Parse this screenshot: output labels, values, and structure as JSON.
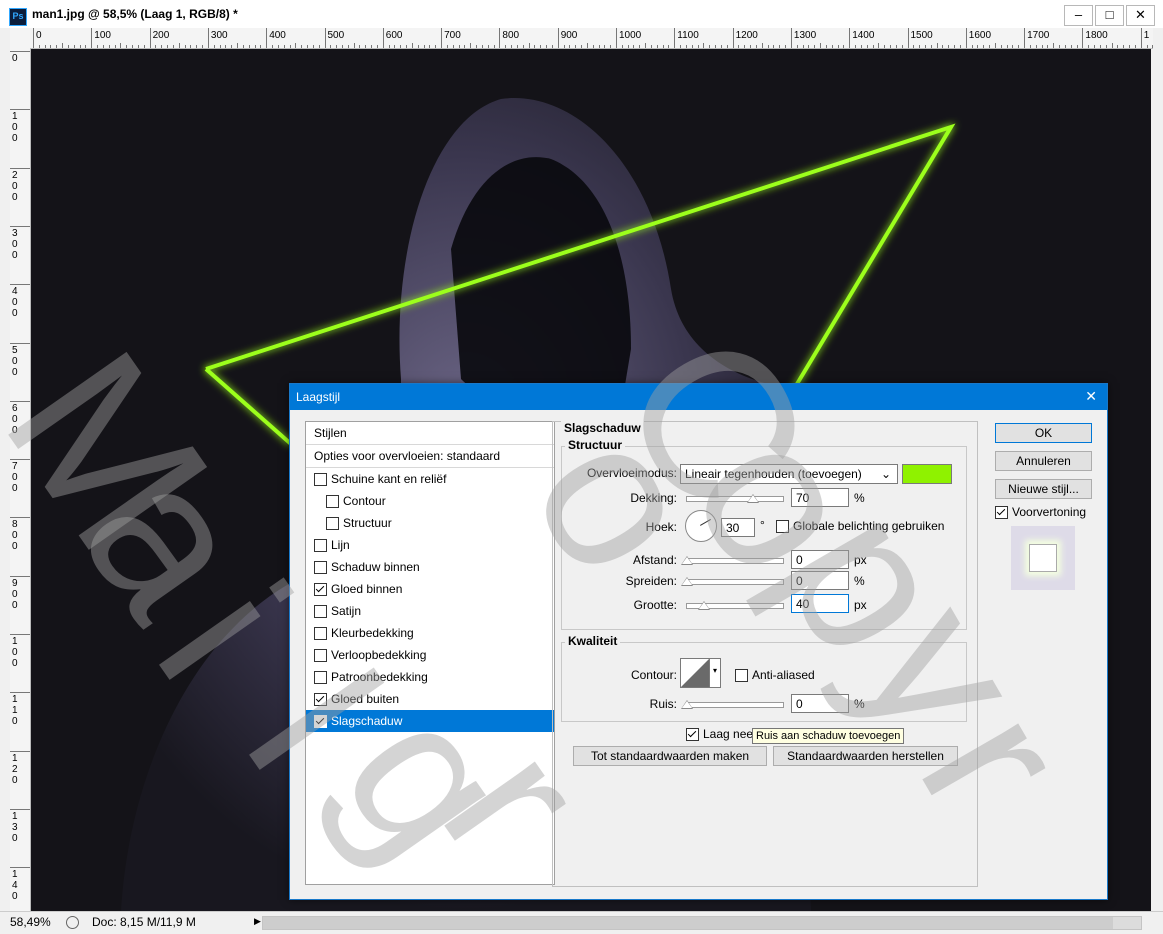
{
  "app": {
    "logo": "Ps",
    "window_title": "man1.jpg @ 58,5% (Laag 1, RGB/8) *",
    "window_buttons": [
      "–",
      "□",
      "✕"
    ]
  },
  "ruler": {
    "top_labels": [
      "0",
      "100",
      "200",
      "300",
      "400",
      "500",
      "600",
      "700",
      "800",
      "900",
      "1000",
      "1100",
      "1200",
      "1300",
      "1400",
      "1500",
      "1600",
      "1700",
      "1800",
      "1"
    ],
    "left_labels": [
      "0",
      "1 0 0",
      "2 0 0",
      "3 0 0",
      "4 0 0",
      "5 0 0",
      "6 0 0",
      "7 0 0",
      "8 0 0",
      "9 0 0",
      "1 0 0",
      "1 1 0",
      "1 2 0",
      "1 3 0",
      "1 4 0"
    ]
  },
  "status": {
    "zoom": "58,49%",
    "doc": "Doc: 8,15 M/11,9 M",
    "arrow": "▶"
  },
  "dialog": {
    "title": "Laagstijl",
    "close": "✕",
    "styles_header": "Stijlen",
    "blend_options": "Opties voor overvloeien: standaard",
    "styles": [
      {
        "label": "Schuine kant en reliëf",
        "checked": false,
        "indent": false
      },
      {
        "label": "Contour",
        "checked": false,
        "indent": true
      },
      {
        "label": "Structuur",
        "checked": false,
        "indent": true
      },
      {
        "label": "Lijn",
        "checked": false,
        "indent": false
      },
      {
        "label": "Schaduw binnen",
        "checked": false,
        "indent": false
      },
      {
        "label": "Gloed binnen",
        "checked": true,
        "indent": false
      },
      {
        "label": "Satijn",
        "checked": false,
        "indent": false
      },
      {
        "label": "Kleurbedekking",
        "checked": false,
        "indent": false
      },
      {
        "label": "Verloopbedekking",
        "checked": false,
        "indent": false
      },
      {
        "label": "Patroonbedekking",
        "checked": false,
        "indent": false
      },
      {
        "label": "Gloed buiten",
        "checked": true,
        "indent": false
      },
      {
        "label": "Slagschaduw",
        "checked": true,
        "indent": false,
        "selected": true
      }
    ],
    "section_title": "Slagschaduw",
    "structure_title": "Structuur",
    "blend_mode_label": "Overvloeimodus:",
    "blend_mode_value": "Lineair tegenhouden (toevoegen)",
    "color": "#8ff200",
    "opacity_label": "Dekking:",
    "opacity_value": "70",
    "opacity_level": 0.7,
    "percent": "%",
    "angle_label": "Hoek:",
    "angle_value": "30",
    "degree": "°",
    "global_light_label": "Globale belichting gebruiken",
    "distance_label": "Afstand:",
    "distance_value": "0",
    "spread_label": "Spreiden:",
    "spread_value": "0",
    "size_label": "Grootte:",
    "size_value": "40",
    "px": "px",
    "quality_title": "Kwaliteit",
    "contour_label": "Contour:",
    "antialias_label": "Anti-aliased",
    "noise_label": "Ruis:",
    "noise_value": "0",
    "knockout_label": "Laag neem",
    "tooltip": "Ruis aan schaduw toevoegen",
    "make_default": "Tot standaardwaarden maken",
    "reset_default": "Standaardwaarden herstellen",
    "ok": "OK",
    "cancel": "Annuleren",
    "new_style": "Nieuwe stijl...",
    "preview_label": "Voorvertoning"
  },
  "watermark": [
    "M",
    "a",
    "i",
    "l",
    "g",
    "r",
    "o",
    "C",
    "o",
    "p",
    "y",
    "r"
  ]
}
